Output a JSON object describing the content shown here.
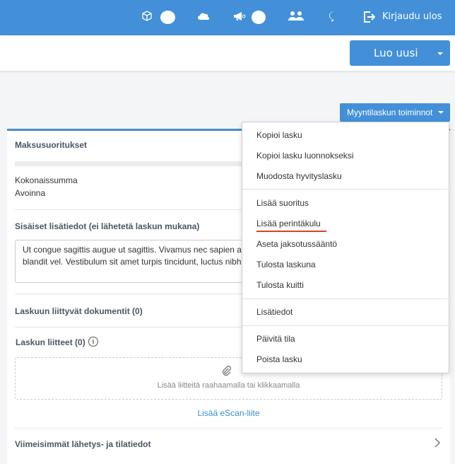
{
  "topbar": {
    "logout_label": "Kirjaudu ulos",
    "icons": [
      "box-icon",
      "cloud-icon",
      "megaphone-icon",
      "users-icon",
      "alert-bubble-icon",
      "logout-icon"
    ]
  },
  "toolbar": {
    "create_label": "Luo uusi",
    "actions_label": "Myyntilaskun toiminnot"
  },
  "card": {
    "payments_title": "Maksusuoritukset",
    "total_label": "Kokonaissumma",
    "open_label": "Avoinna",
    "internal_title": "Sisäiset lisätiedot (ei lähetetä laskun mukana)",
    "internal_line1": "Ut congue sagittis augue ut sagittis. Vivamus nec sapien a",
    "internal_line2": "blandit vel. Vestibulum sit amet turpis tincidunt, luctus nibh",
    "documents_title": "Laskuun liittyvät dokumentit (0)",
    "attachments_title": "Laskun liitteet (0)",
    "drop_text": "Lisää liitteitä raahaamalla tai klikkaamalla",
    "escan_link": "Lisää eScan-liite",
    "history_title": "Viimeisimmät lähetys- ja tilatiedot"
  },
  "menu": {
    "items": [
      "Kopioi lasku",
      "Kopioi lasku luonnokseksi",
      "Muodosta hyvityslasku",
      "Lisää suoritus",
      "Lisää perintäkulu",
      "Aseta jaksotussääntö",
      "Tulosta laskuna",
      "Tulosta kuitti",
      "Lisätiedot",
      "Päivitä tila",
      "Poista lasku"
    ]
  },
  "colors": {
    "brand": "#4390d9",
    "highlight": "#d9412b"
  }
}
